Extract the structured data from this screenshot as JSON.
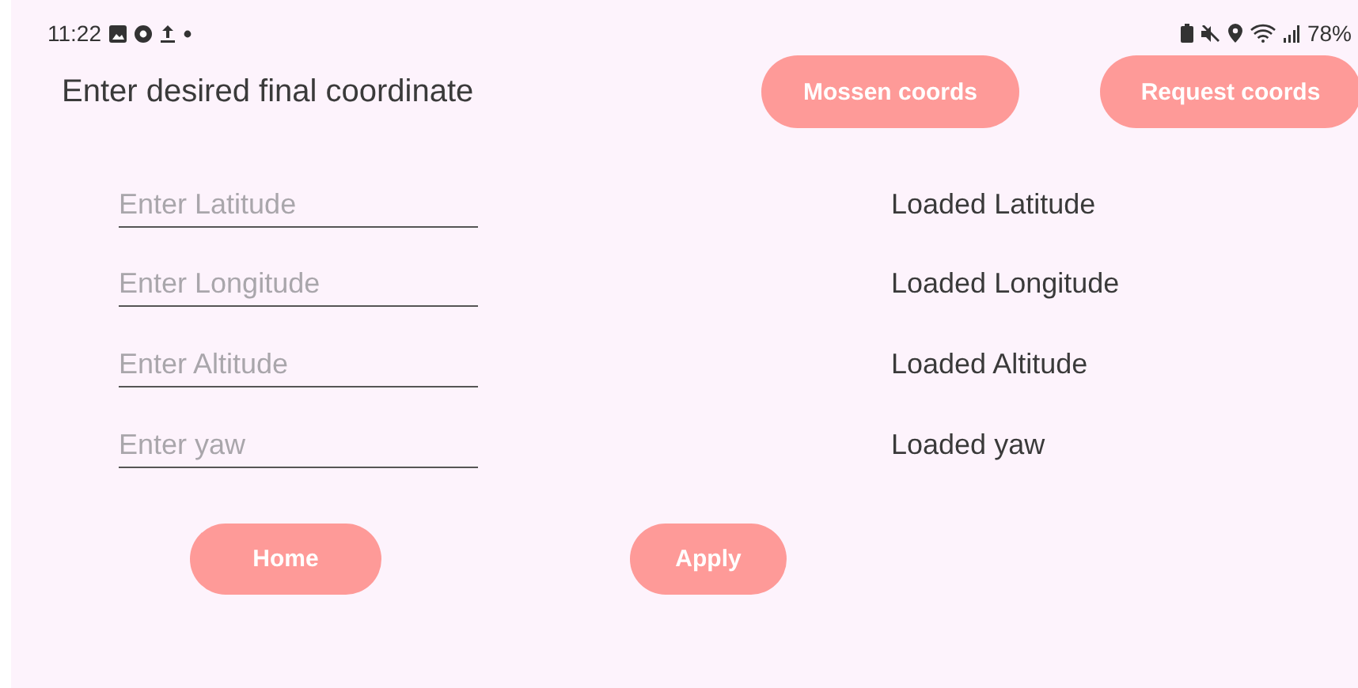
{
  "status_bar": {
    "time": "11:22",
    "battery": "78%"
  },
  "title": "Enter desired final coordinate",
  "top_buttons": [
    "Mossen coords",
    "Request coords"
  ],
  "rows": [
    {
      "placeholder": "Enter Latitude",
      "loaded": "Loaded Latitude"
    },
    {
      "placeholder": "Enter Longitude",
      "loaded": "Loaded Longitude"
    },
    {
      "placeholder": "Enter Altitude",
      "loaded": "Loaded Altitude"
    },
    {
      "placeholder": "Enter yaw",
      "loaded": "Loaded yaw"
    }
  ],
  "bottom_buttons": [
    "Home",
    "Apply"
  ]
}
